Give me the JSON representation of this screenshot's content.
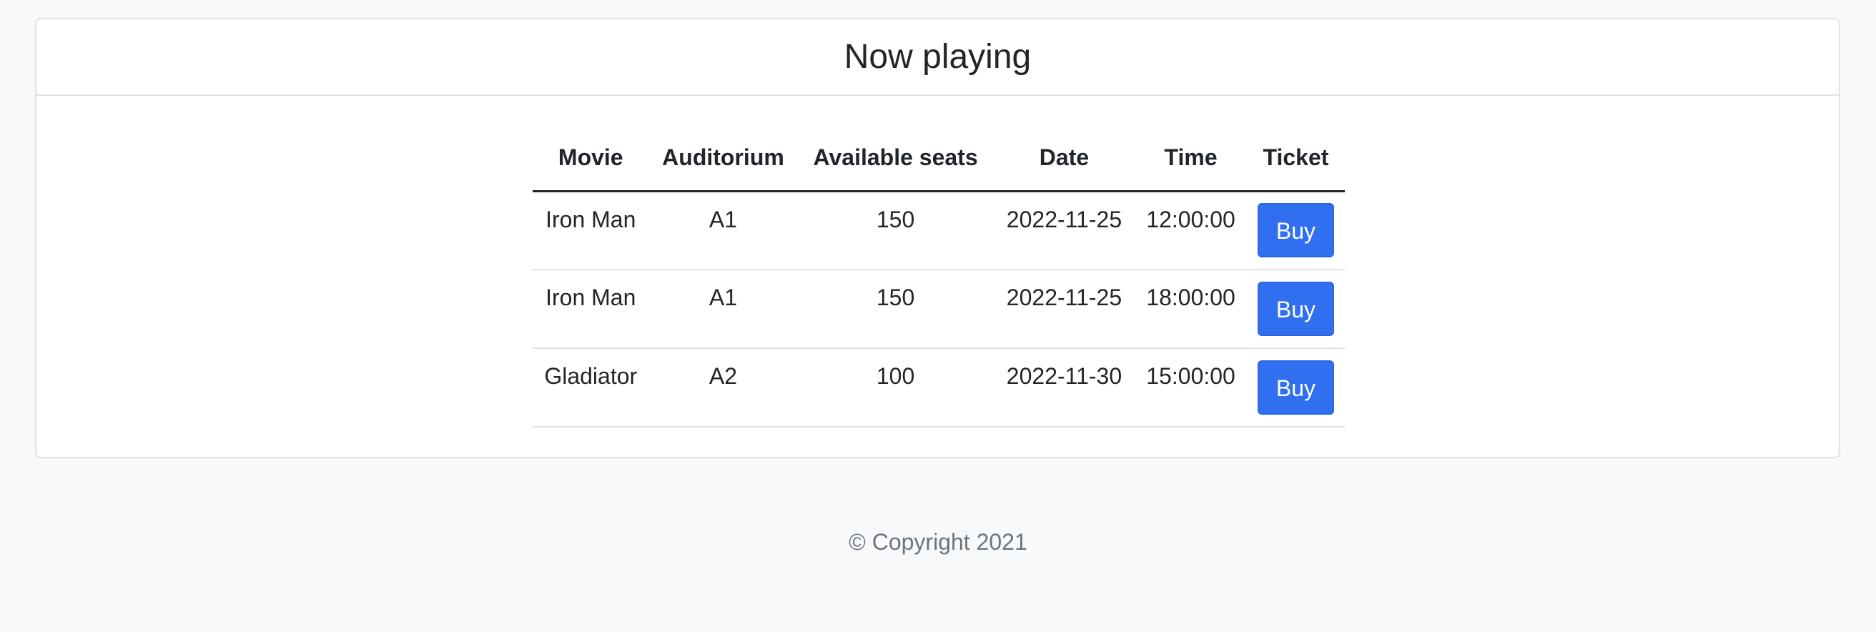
{
  "header": {
    "title": "Now playing"
  },
  "table": {
    "columns": [
      "Movie",
      "Auditorium",
      "Available seats",
      "Date",
      "Time",
      "Ticket"
    ],
    "rows": [
      {
        "movie": "Iron Man",
        "auditorium": "A1",
        "seats": "150",
        "date": "2022-11-25",
        "time": "12:00:00",
        "button": "Buy"
      },
      {
        "movie": "Iron Man",
        "auditorium": "A1",
        "seats": "150",
        "date": "2022-11-25",
        "time": "18:00:00",
        "button": "Buy"
      },
      {
        "movie": "Gladiator",
        "auditorium": "A2",
        "seats": "100",
        "date": "2022-11-30",
        "time": "15:00:00",
        "button": "Buy"
      }
    ]
  },
  "footer": {
    "copyright": "© Copyright 2021"
  },
  "colors": {
    "primary": "#2f6ff0",
    "background": "#f8f9fa",
    "border": "#dee2e6",
    "muted": "#6c757d"
  }
}
